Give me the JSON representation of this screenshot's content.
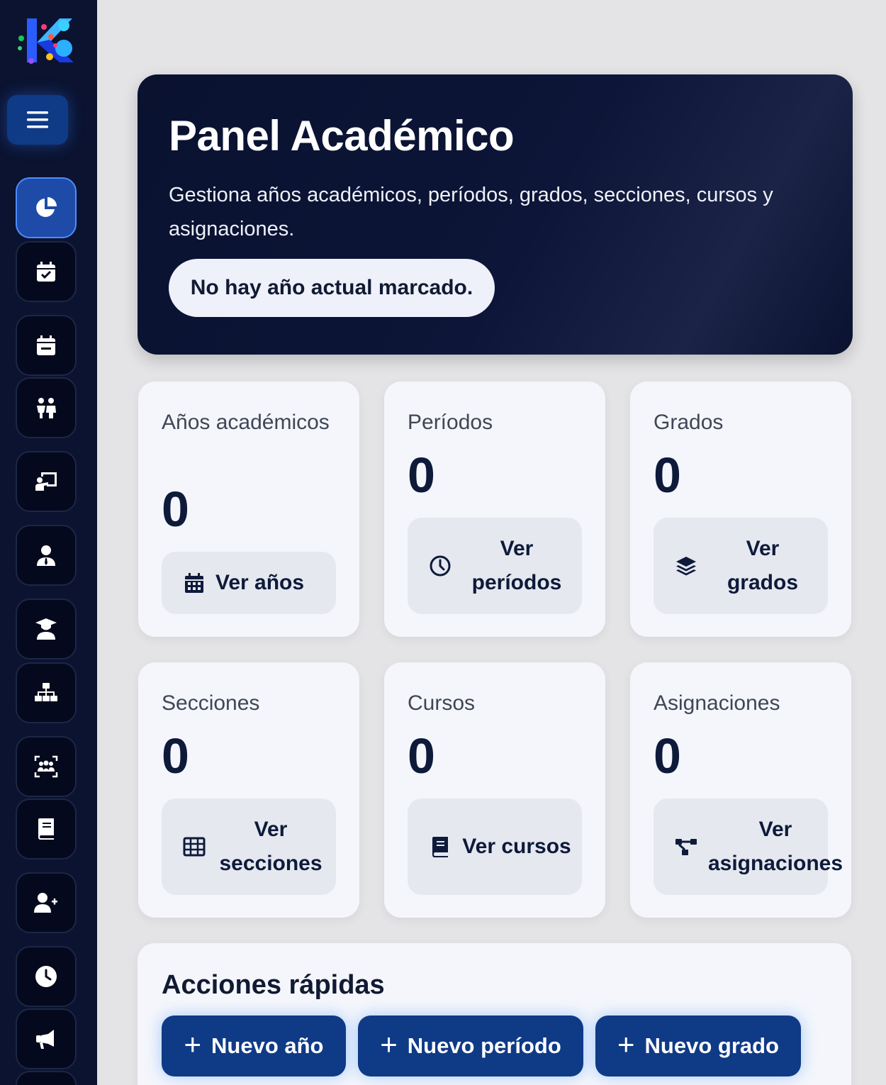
{
  "sidebar": {
    "logo_icon": "brand-logo-icon",
    "menu_icon": "hamburger-icon",
    "items": [
      {
        "icon": "pie-chart-icon",
        "active": true
      },
      {
        "icon": "calendar-check-icon",
        "active": false
      },
      {
        "icon": "calendar-minus-icon",
        "active": false
      },
      {
        "icon": "children-icon",
        "active": false
      },
      {
        "icon": "teacher-board-icon",
        "active": false
      },
      {
        "icon": "user-tie-icon",
        "active": false
      },
      {
        "icon": "graduate-icon",
        "active": false
      },
      {
        "icon": "sitemap-icon",
        "active": false
      },
      {
        "icon": "group-scan-icon",
        "active": false
      },
      {
        "icon": "book-icon",
        "active": false
      },
      {
        "icon": "user-plus-icon",
        "active": false
      },
      {
        "icon": "clock-icon",
        "active": false
      },
      {
        "icon": "megaphone-icon",
        "active": false
      }
    ]
  },
  "hero": {
    "title": "Panel Académico",
    "subtitle": "Gestiona años académicos, períodos, grados, secciones, cursos y asignaciones.",
    "status_pill": "No hay año actual marcado."
  },
  "cards": [
    {
      "label": "Años académicos",
      "value": "0",
      "button": "Ver años",
      "icon": "calendar-grid-icon"
    },
    {
      "label": "Períodos",
      "value": "0",
      "button": "Ver períodos",
      "icon": "clock-outline-icon"
    },
    {
      "label": "Grados",
      "value": "0",
      "button": "Ver grados",
      "icon": "layers-icon"
    },
    {
      "label": "Secciones",
      "value": "0",
      "button": "Ver secciones",
      "icon": "table-icon"
    },
    {
      "label": "Cursos",
      "value": "0",
      "button": "Ver cursos",
      "icon": "book-icon"
    },
    {
      "label": "Asignaciones",
      "value": "0",
      "button": "Ver asignaciones",
      "icon": "diagram-icon"
    }
  ],
  "quick_actions": {
    "title": "Acciones rápidas",
    "buttons": [
      "Nuevo año",
      "Nuevo período",
      "Nuevo grado"
    ]
  },
  "colors": {
    "sidebar_bg": "#0b1330",
    "hero_bg": "#0a1230",
    "primary": "#0f3a86",
    "active_nav": "#1e4ba8",
    "page_bg": "#e4e4e6"
  }
}
